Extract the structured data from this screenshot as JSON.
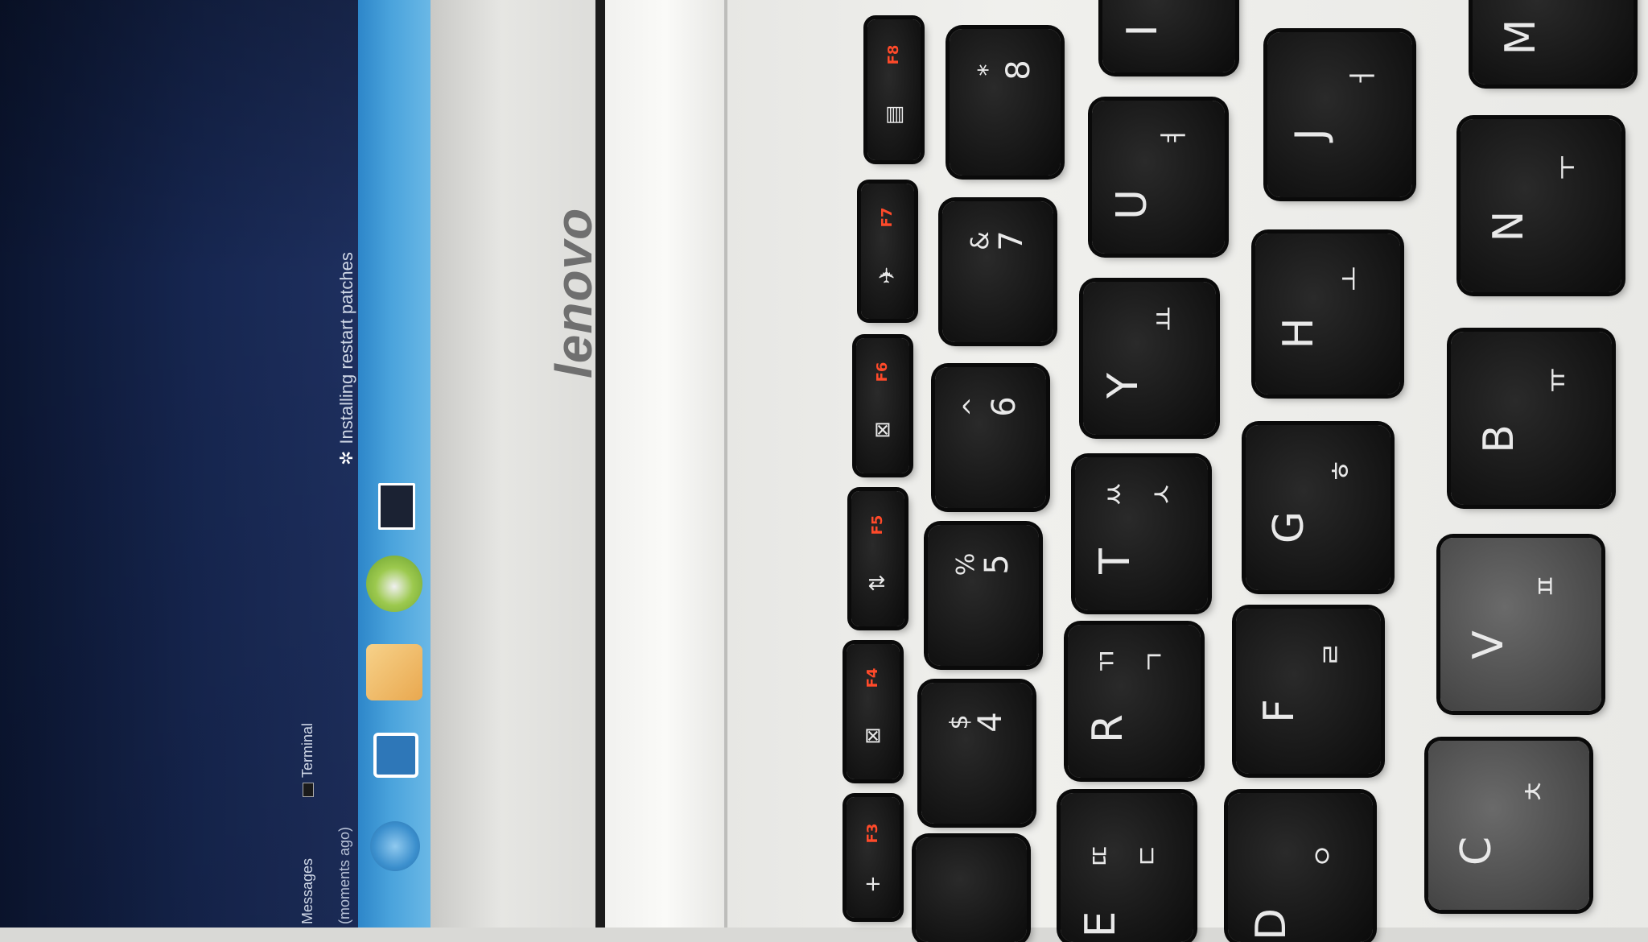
{
  "screen": {
    "notification": "Installing restart patches",
    "messages_label": "Messages",
    "moments_label": "(moments ago)",
    "terminal_label": "Terminal"
  },
  "bezel": {
    "logo": "lenovo"
  },
  "keyboard": {
    "function_keys": [
      {
        "label": "F3",
        "icon": "+"
      },
      {
        "label": "F4",
        "icon": "⊠"
      },
      {
        "label": "F5",
        "icon": "⇅"
      },
      {
        "label": "F6",
        "icon": "⊠"
      },
      {
        "label": "F7",
        "icon": "✈"
      },
      {
        "label": "F8",
        "icon": "▤"
      }
    ],
    "number_keys": [
      {
        "main": "4",
        "shift": "$"
      },
      {
        "main": "5",
        "shift": "%"
      },
      {
        "main": "6",
        "shift": "^"
      },
      {
        "main": "7",
        "shift": "&"
      },
      {
        "main": "8",
        "shift": "*"
      }
    ],
    "top_row": [
      {
        "main": "E",
        "kor": "ㄸ",
        "kor2": "ㄷ"
      },
      {
        "main": "R",
        "kor": "ㄲ",
        "kor2": "ㄱ"
      },
      {
        "main": "T",
        "kor": "ㅆ",
        "kor2": "ㅅ"
      },
      {
        "main": "Y",
        "kor": "ㅛ"
      },
      {
        "main": "U",
        "kor": "ㅕ"
      },
      {
        "main": "I"
      }
    ],
    "home_row": [
      {
        "main": "D",
        "kor": "ㅇ"
      },
      {
        "main": "F",
        "kor": "ㄹ"
      },
      {
        "main": "G",
        "kor": "ㅎ"
      },
      {
        "main": "H",
        "kor": "ㅗ"
      },
      {
        "main": "J",
        "kor": "ㅓ"
      }
    ],
    "bottom_row": [
      {
        "main": "C",
        "kor": "ㅊ"
      },
      {
        "main": "V",
        "kor": "ㅍ"
      },
      {
        "main": "B",
        "kor": "ㅠ"
      },
      {
        "main": "N",
        "kor": "ㅜ"
      },
      {
        "main": "M"
      }
    ]
  },
  "colors": {
    "fn_label": "#ff4a2a",
    "key_face": "#141414",
    "taskbar": "#4aa3dc"
  }
}
